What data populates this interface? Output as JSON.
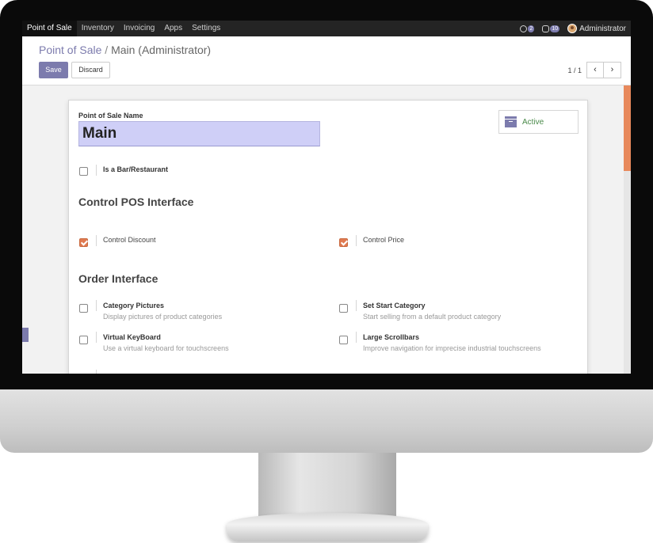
{
  "topnav": {
    "items": [
      "Point of Sale",
      "Inventory",
      "Invoicing",
      "Apps",
      "Settings"
    ],
    "activity_count": "2",
    "messages_count": "10",
    "user_name": "Administrator"
  },
  "breadcrumb": {
    "parent": "Point of Sale",
    "separator": "/",
    "current": "Main (Administrator)"
  },
  "actions": {
    "save": "Save",
    "discard": "Discard"
  },
  "pager": {
    "value": "1 / 1",
    "prev": "‹",
    "next": "›"
  },
  "form": {
    "name_label": "Point of Sale Name",
    "name_value": "Main",
    "active_label": "Active",
    "bar_restaurant": {
      "label": "Is a Bar/Restaurant",
      "checked": false
    },
    "control_section": "Control POS Interface",
    "control_discount": {
      "label": "Control Discount",
      "checked": true
    },
    "control_price": {
      "label": "Control Price",
      "checked": true
    },
    "order_section": "Order Interface",
    "category_pictures": {
      "label": "Category Pictures",
      "desc": "Display pictures of product categories",
      "checked": false
    },
    "set_start_category": {
      "label": "Set Start Category",
      "desc": "Start selling from a default product category",
      "checked": false
    },
    "virtual_keyboard": {
      "label": "Virtual KeyBoard",
      "desc": "Use a virtual keyboard for touchscreens",
      "checked": false
    },
    "large_scrollbars": {
      "label": "Large Scrollbars",
      "desc": "Improve navigation for imprecise industrial touchscreens",
      "checked": false
    }
  },
  "colors": {
    "brand": "#7c7bad",
    "checkbox_checked": "#e07a50",
    "name_input_bg": "#cfcff7",
    "active_text": "#4a8a4a"
  }
}
